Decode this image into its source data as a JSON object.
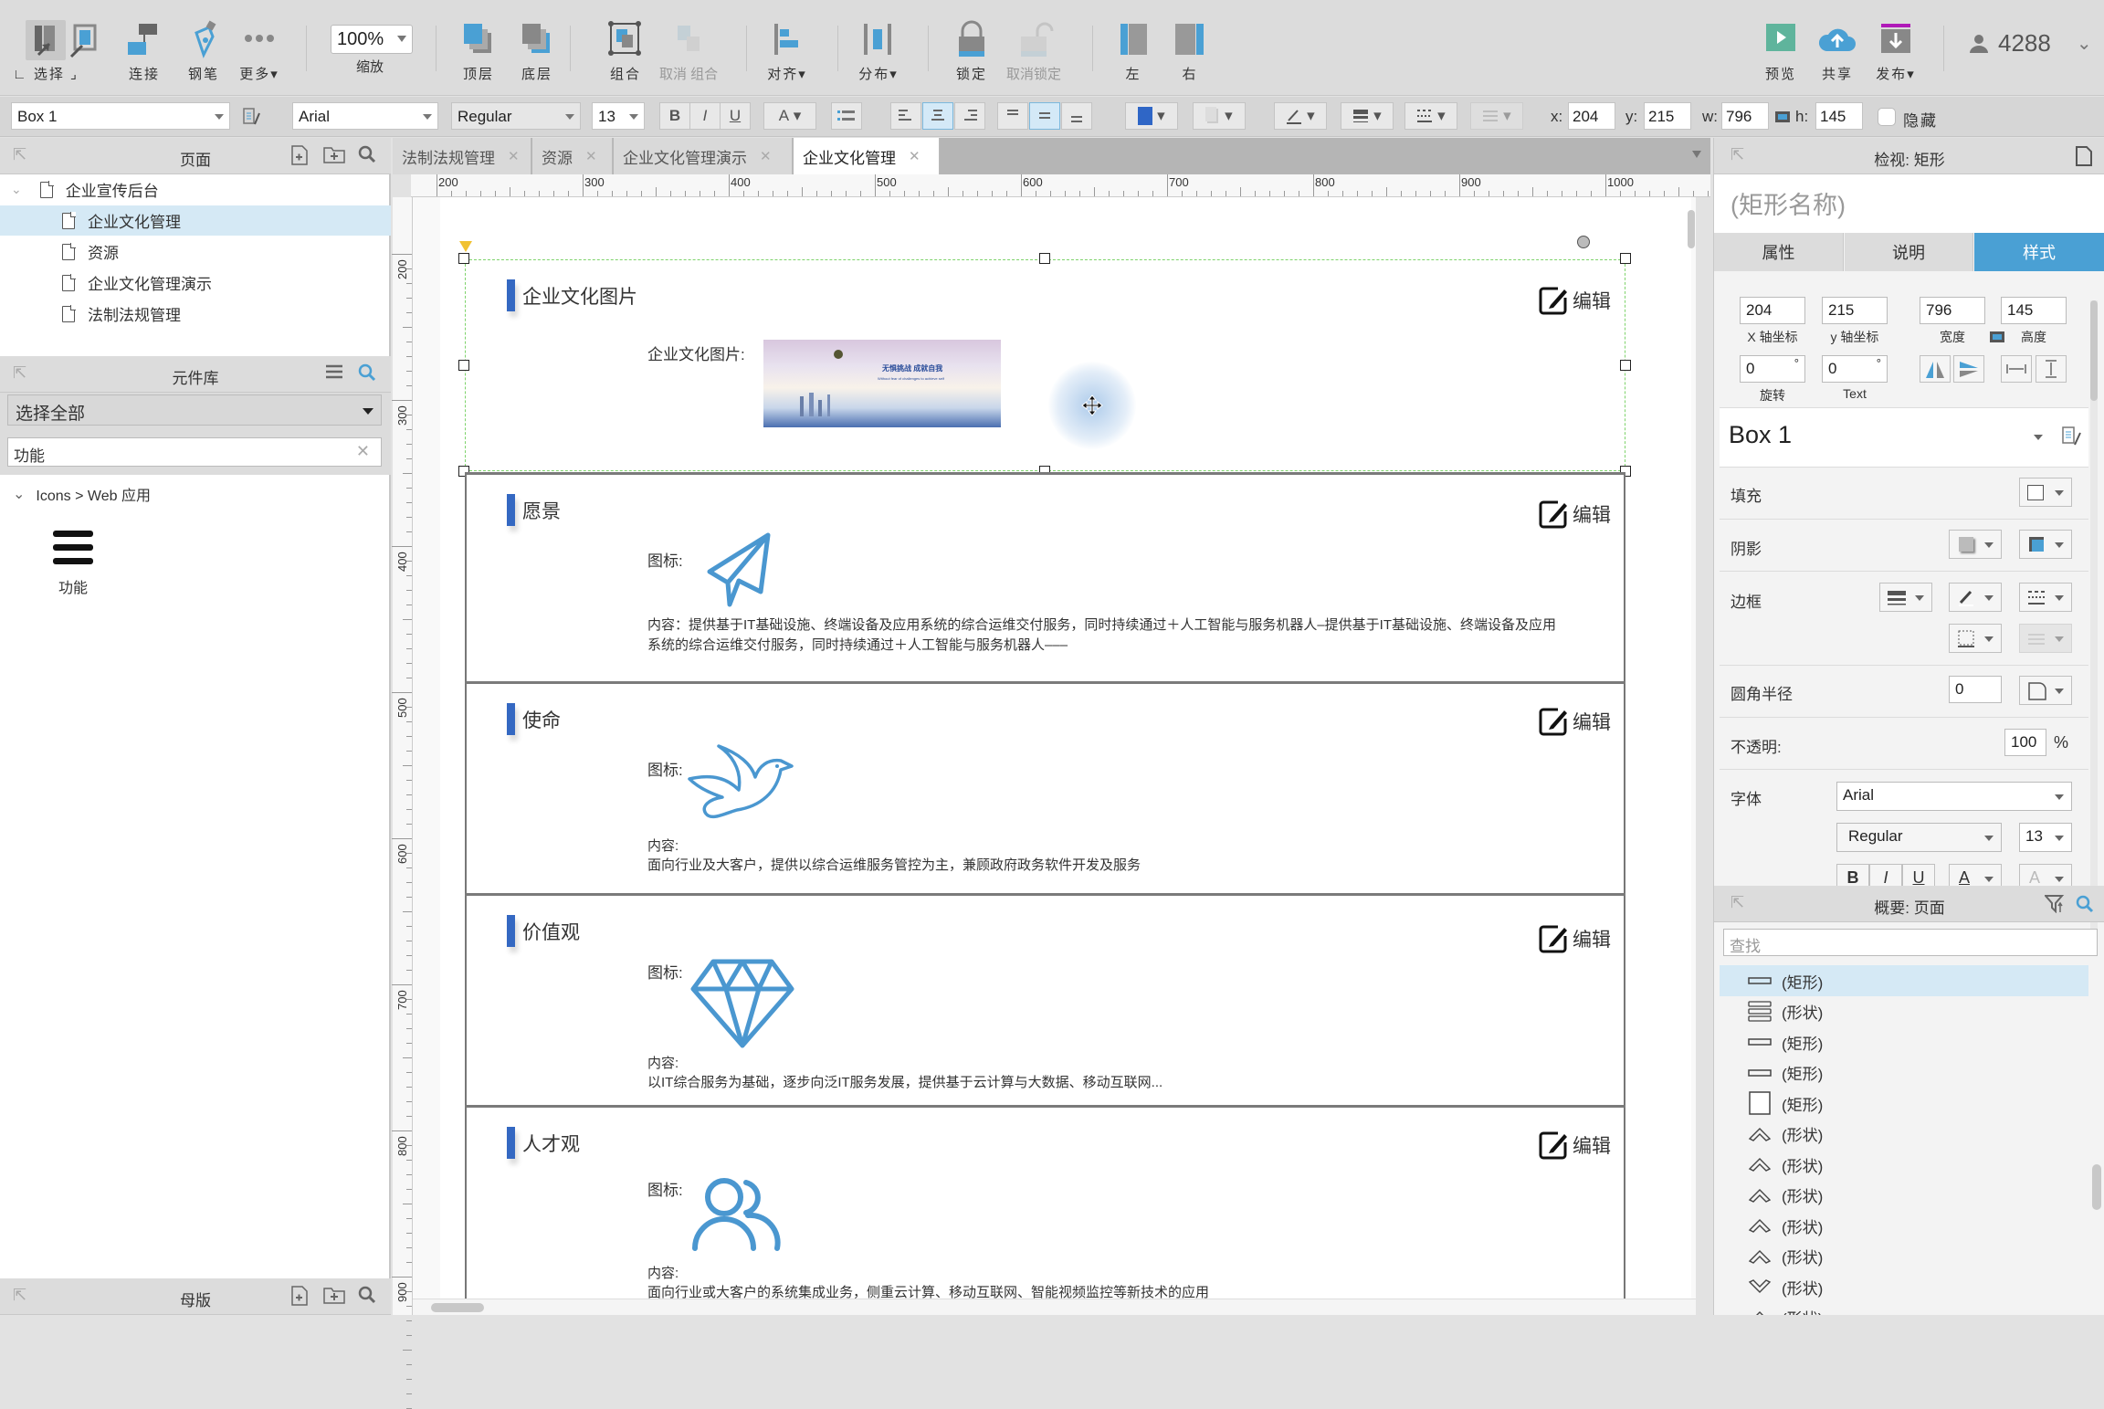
{
  "toolbar": {
    "select_label": "选择",
    "connect_label": "连接",
    "pen_label": "钢笔",
    "more_label": "更多▾",
    "zoom_value": "100%",
    "zoom_label": "缩放",
    "front_label": "顶层",
    "back_label": "底层",
    "group_label": "组合",
    "ungroup_label": "取消 组合",
    "align_label": "对齐▾",
    "distribute_label": "分布▾",
    "lock_label": "锁定",
    "unlock_label": "取消锁定",
    "left_label": "左",
    "right_label": "右",
    "preview_label": "预览",
    "share_label": "共享",
    "publish_label": "发布▾",
    "user_id": "4288"
  },
  "format_bar": {
    "style_name": "Box 1",
    "font_family": "Arial",
    "font_weight": "Regular",
    "font_size": "13",
    "bold": "B",
    "italic": "I",
    "underline": "U",
    "font_color": "A",
    "x_label": "x:",
    "x": "204",
    "y_label": "y:",
    "y": "215",
    "w_label": "w:",
    "w": "796",
    "h_label": "h:",
    "h": "145",
    "hide_label": "隐藏"
  },
  "pages_panel": {
    "title": "页面",
    "root": "企业宣传后台",
    "items": [
      {
        "label": "企业文化管理",
        "selected": true
      },
      {
        "label": "资源",
        "selected": false
      },
      {
        "label": "企业文化管理演示",
        "selected": false
      },
      {
        "label": "法制法规管理",
        "selected": false
      }
    ]
  },
  "library_panel": {
    "title": "元件库",
    "select_value": "选择全部",
    "search_value": "功能",
    "category": "Icons > Web 应用",
    "widget_label": "功能"
  },
  "masters_panel": {
    "title": "母版"
  },
  "tabs": [
    {
      "label": "法制法规管理",
      "active": false
    },
    {
      "label": "资源",
      "active": false
    },
    {
      "label": "企业文化管理演示",
      "active": false
    },
    {
      "label": "企业文化管理",
      "active": true
    }
  ],
  "rulers": {
    "h": [
      "200",
      "300",
      "400",
      "500",
      "600",
      "700",
      "800",
      "900",
      "1000"
    ],
    "v": [
      "200",
      "300",
      "400",
      "500",
      "600",
      "700",
      "800",
      "900"
    ]
  },
  "canvas": {
    "edit_label": "编辑",
    "icon_label": "图标:",
    "content_label": "内容:",
    "sections": [
      {
        "title": "企业文化图片",
        "image_label": "企业文化图片:",
        "banner_text": "无惧挑战 成就自我",
        "banner_sub": "Without fear of challenges to achieve self"
      },
      {
        "title": "愿景",
        "icon": "paper-plane-icon",
        "content": "内容：提供基于IT基础设施、终端设备及应用系统的综合运维交付服务，同时持续通过＋人工智能与服务机器人–提供基于IT基础设施、终端设备及应用系统的综合运维交付服务，同时持续通过＋人工智能与服务机器人–––"
      },
      {
        "title": "使命",
        "icon": "dove-icon",
        "content": "面向行业及大客户，提供以综合运维服务管控为主，兼顾政府政务软件开发及服务"
      },
      {
        "title": "价值观",
        "icon": "diamond-icon",
        "content": "以IT综合服务为基础，逐步向泛IT服务发展，提供基于云计算与大数据、移动互联网..."
      },
      {
        "title": "人才观",
        "icon": "users-icon",
        "content": "面向行业或大客户的系统集成业务，侧重云计算、移动互联网、智能视频监控等新技术的应用"
      }
    ]
  },
  "inspector": {
    "title": "检视: 矩形",
    "name_placeholder": "(矩形名称)",
    "tabs": [
      {
        "label": "属性",
        "active": false
      },
      {
        "label": "说明",
        "active": false
      },
      {
        "label": "样式",
        "active": true
      }
    ],
    "x": "204",
    "x_caption": "X 轴坐标",
    "y": "215",
    "y_caption": "y 轴坐标",
    "w": "796",
    "w_caption": "宽度",
    "h": "145",
    "h_caption": "高度",
    "rotation": "0",
    "rotation_caption": "旋转",
    "text_rotation": "0",
    "text_caption": "Text",
    "style_name": "Box 1",
    "fill_label": "填充",
    "shadow_label": "阴影",
    "border_label": "边框",
    "radius_label": "圆角半径",
    "radius": "0",
    "opacity_label": "不透明:",
    "opacity": "100",
    "percent": "%",
    "font_label": "字体",
    "font_family": "Arial",
    "font_weight": "Regular",
    "font_size": "13",
    "shadow_color": "#4aa0d4"
  },
  "outline": {
    "title": "概要: 页面",
    "search_placeholder": "查找",
    "items": [
      {
        "label": "(矩形)",
        "icon": "rect-thin",
        "selected": true
      },
      {
        "label": "(形状)",
        "icon": "menu",
        "selected": false
      },
      {
        "label": "(矩形)",
        "icon": "rect-thin",
        "selected": false
      },
      {
        "label": "(矩形)",
        "icon": "rect-thin",
        "selected": false
      },
      {
        "label": "(矩形)",
        "icon": "square",
        "selected": false
      },
      {
        "label": "(形状)",
        "icon": "chevron-up",
        "selected": false
      },
      {
        "label": "(形状)",
        "icon": "chevron-up",
        "selected": false
      },
      {
        "label": "(形状)",
        "icon": "chevron-up",
        "selected": false
      },
      {
        "label": "(形状)",
        "icon": "chevron-up",
        "selected": false
      },
      {
        "label": "(形状)",
        "icon": "chevron-up",
        "selected": false
      },
      {
        "label": "(形状)",
        "icon": "chevron-down",
        "selected": false
      },
      {
        "label": "(形状)",
        "icon": "chevron-up",
        "selected": false
      }
    ]
  },
  "colors": {
    "accent": "#4aa0d4",
    "section_bar": "#3468c2",
    "selection_green": "#7ed36b",
    "icon_blue": "#4a97d0",
    "preview_green": "#5fb49c",
    "publish_magenta": "#b01ab8"
  }
}
